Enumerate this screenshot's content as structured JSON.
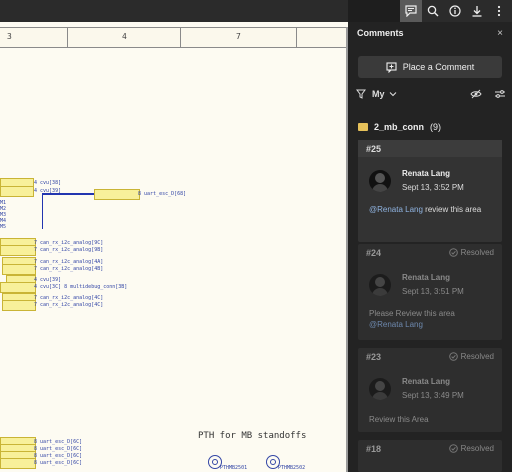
{
  "toolbar": {
    "icons": [
      "comment-icon",
      "search-icon",
      "info-icon",
      "download-icon",
      "more-icon"
    ]
  },
  "schematic": {
    "ruler_numbers": [
      "3",
      "4",
      "7"
    ],
    "pth_title": "PTH for MB standoffs",
    "pth_labels": [
      "PTHMB2501",
      "PTHMB2502"
    ]
  },
  "panel": {
    "title": "Comments",
    "close": "×",
    "place_button": "Place a Comment",
    "filter": "My",
    "folder": {
      "name": "2_mb_conn",
      "count": "(9)"
    },
    "comments": [
      {
        "id": "#25",
        "author": "Renata Lang",
        "date": "Sept 13, 3:52 PM",
        "mention": "@Renata Lang",
        "text": " review this area",
        "status": ""
      },
      {
        "id": "#24",
        "author": "Renata Lang",
        "date": "Sept 13, 3:51 PM",
        "text": "Please Review this area",
        "mention": "@Renata Lang",
        "status": "Resolved"
      },
      {
        "id": "#23",
        "author": "Renata Lang",
        "date": "Sept 13, 3:49 PM",
        "text": "Review this Area",
        "status": "Resolved"
      },
      {
        "id": "#18",
        "status": "Resolved"
      }
    ]
  },
  "colors": {
    "panel_bg": "#232323",
    "net_label": "#f8f09a",
    "wire": "#2235b0",
    "mention": "#8fb3e0",
    "folder": "#e6c15a"
  }
}
